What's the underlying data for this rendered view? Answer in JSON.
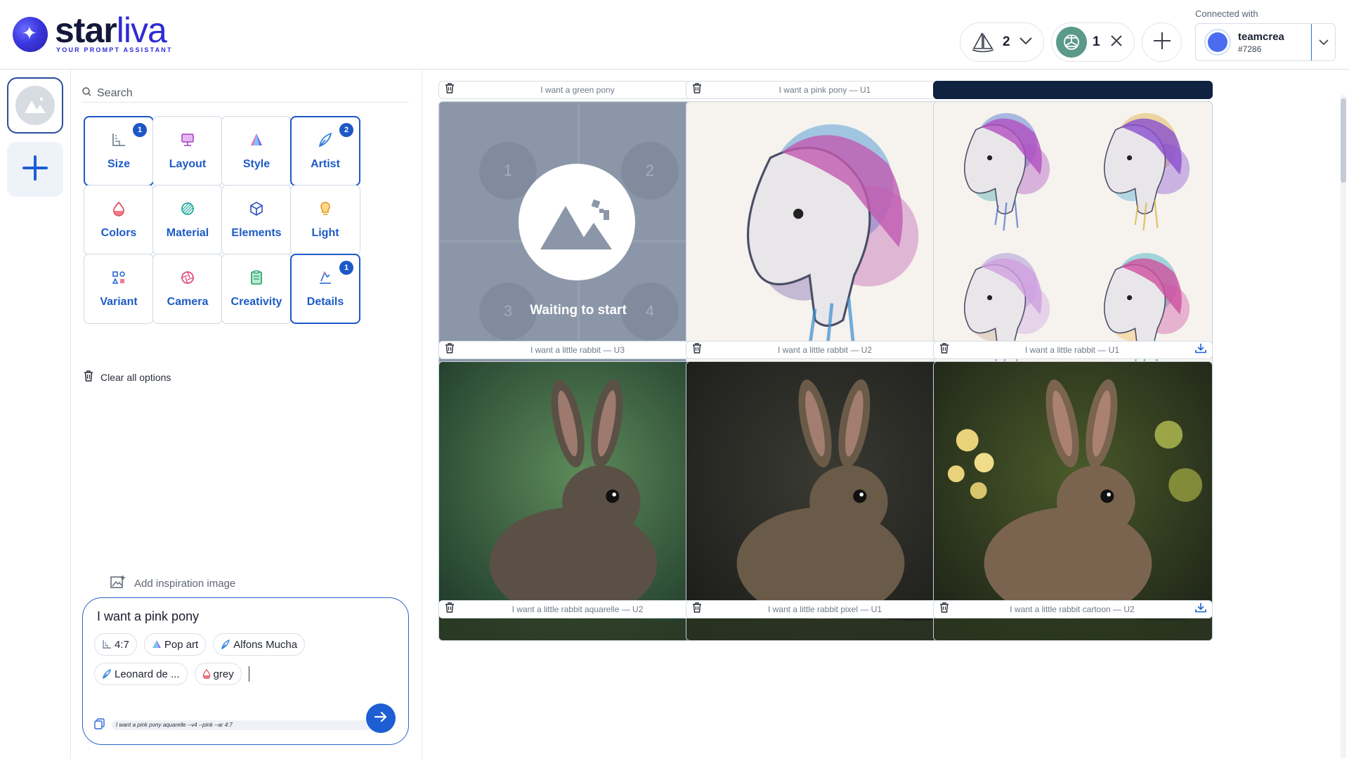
{
  "brand": {
    "name_part1": "star",
    "name_part2": "liva",
    "tagline": "YOUR PROMPT ASSISTANT"
  },
  "header": {
    "midjourney_count": "2",
    "chatgpt_count": "1",
    "connected_label": "Connected with",
    "discord_user": "teamcrea",
    "discord_tag": "#7286"
  },
  "search": {
    "placeholder": "Search"
  },
  "options": [
    {
      "label": "Size",
      "icon": "ruler-icon",
      "badge": "1",
      "active": true
    },
    {
      "label": "Layout",
      "icon": "easel-icon",
      "badge": "",
      "active": false
    },
    {
      "label": "Style",
      "icon": "prism-icon",
      "badge": "",
      "active": false
    },
    {
      "label": "Artist",
      "icon": "pen-nib-icon",
      "badge": "2",
      "active": true
    },
    {
      "label": "Colors",
      "icon": "drop-icon",
      "badge": "",
      "active": false
    },
    {
      "label": "Material",
      "icon": "material-sphere-icon",
      "badge": "",
      "active": false
    },
    {
      "label": "Elements",
      "icon": "cube-icon",
      "badge": "",
      "active": false
    },
    {
      "label": "Light",
      "icon": "lightbulb-icon",
      "badge": "",
      "active": false
    },
    {
      "label": "Variant",
      "icon": "shapes-icon",
      "badge": "",
      "active": false
    },
    {
      "label": "Camera",
      "icon": "aperture-icon",
      "badge": "",
      "active": false
    },
    {
      "label": "Creativity",
      "icon": "clipboard-icon",
      "badge": "",
      "active": false
    },
    {
      "label": "Details",
      "icon": "details-icon",
      "badge": "1",
      "active": true
    }
  ],
  "clear_all_label": "Clear all options",
  "add_inspiration_label": "Add inspiration image",
  "prompt": {
    "text": "I want a pink pony",
    "chips": [
      "4:7",
      "Pop art",
      "Alfons Mucha",
      "Leonard de ...",
      "grey"
    ],
    "generated": "I want a pink pony aquarelle --v4 --pink --ar 4:7"
  },
  "gallery": {
    "cards": [
      {
        "title": "I want a green pony",
        "kind": "waiting"
      },
      {
        "title": "I want a pink pony — U1",
        "kind": "pony-single"
      },
      {
        "title": "",
        "kind": "pony-grid"
      },
      {
        "title": "I want a little rabbit — U3",
        "kind": "rabbit-1"
      },
      {
        "title": "I want a little rabbit — U2",
        "kind": "rabbit-2"
      },
      {
        "title": "I want a little rabbit — U1",
        "kind": "rabbit-3"
      },
      {
        "title": "I want a little rabbit aquarelle — U2",
        "kind": "none"
      },
      {
        "title": "I want a little rabbit pixel — U1",
        "kind": "none"
      },
      {
        "title": "I want a little rabbit cartoon — U2",
        "kind": "none"
      }
    ],
    "waiting": {
      "label": "Waiting to start",
      "quadrants": [
        "1",
        "2",
        "3",
        "4"
      ]
    }
  }
}
